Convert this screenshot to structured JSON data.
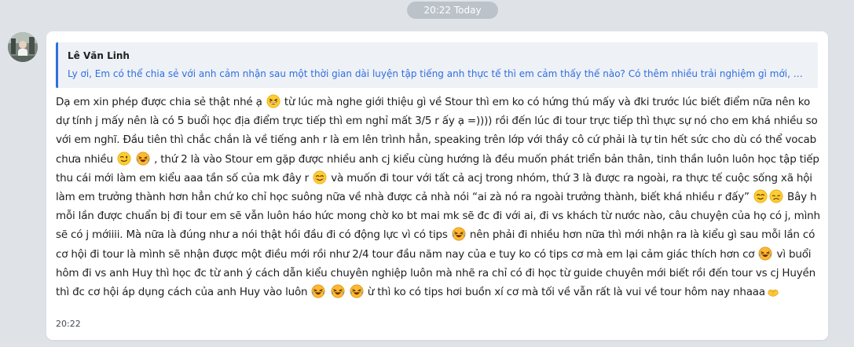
{
  "date_separator": "20:22 Today",
  "quote": {
    "author": "Lê Văn Linh",
    "text": "Ly ơi, Em có thể chia sẻ với anh cảm nhận sau một thời gian dài luyện tập tiếng anh thực tế thì em cảm thấy thế nào? Có thêm nhiều trải nghiệm gì mới, học thêm..."
  },
  "message": {
    "segments": [
      "Dạ em xin phép được chia sẻ thật nhé ạ",
      " từ lúc mà nghe giới thiệu gì về Stour thì em ko có hứng thú mấy và đki trước lúc biết điểm nữa nên ko dự tính j mấy nên là có 5 buổi học địa điểm trực tiếp thì em nghỉ mất 3/5 r ấy ạ =)))) rồi đến lúc đi tour trực tiếp thì thực sự nó cho em khá nhiều so với em nghĩ. Đầu tiên thì chắc chắn là về tiếng anh r là em lên trình hẳn, speaking trên lớp với thầy cô cứ phải là tự tin hết sức cho dù có thể vocab chưa nhiều",
      " , thứ 2 là vào Stour em gặp được nhiều anh cj kiểu cùng hướng là đều muốn phát triển bản thân, tinh thần luôn luôn học tập tiếp thu cái mới làm em kiểu aaa tần số của mk đây r",
      " và muốn đi tour với tất cả acj trong nhóm, thứ 3 là được ra ngoài, ra thực tế cuộc sống xã hội làm em trưởng thành hơn hẳn chứ ko chỉ học suông nữa về nhà được cả nhà nói “ai zà nó ra ngoài trưởng thành, biết khá nhiều r đấy”",
      " Bây h mỗi lần được chuẩn bị đi tour em sẽ vẫn luôn háo hức mong chờ ko bt mai mk sẽ đc đi với ai, đi vs khách từ nước nào, câu chuyện của họ có j, mình sẽ có j mớiiii. Mà nữa là đúng như a nói thật hồi đầu đi có động lực vì có tips",
      " nên phải đi nhiều hơn nữa thì mới nhận ra là kiểu gì sau mỗi lần có cơ hội đi tour là mình sẽ nhận được một điều mới rồi như 2/4 tour đầu năm nay của e tuy ko có tips cơ mà em lại cảm giác thích hơn cơ",
      " vì buổi hôm đi vs anh Huy thì học đc từ anh ý cách dẫn kiểu chuyên nghiệp luôn mà nhẽ ra chỉ có đi học từ guide chuyên mới biết rồi đến tour vs cj Huyền thì đc cơ hội áp dụng cách của anh Huy vào luôn",
      " ừ thì ko có tips hơi buồn xí cơ mà tối về vẫn rất là vui về tour hôm nay nhaaa"
    ],
    "time": "20:22"
  },
  "emoji": {
    "grin": "grinning-squinting-face-icon",
    "wink": "winking-face-icon",
    "rofl": "laughing-crying-face-icon",
    "smile": "smiling-face-icon",
    "sad": "downcast-face-icon",
    "hands": "heart-hands-icon"
  },
  "colors": {
    "background": "#dfe3e8",
    "bubble": "#ffffff",
    "accent": "#2f6fe0",
    "quote_bg": "#eef1f6",
    "text": "#1e1e1e"
  }
}
